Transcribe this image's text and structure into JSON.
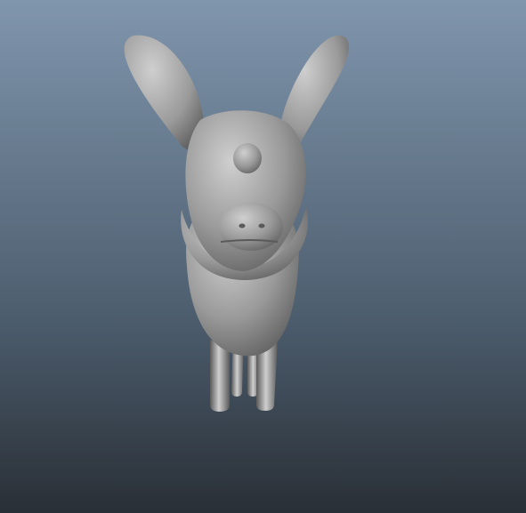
{
  "viewport": {
    "background_top_color": "#8096ad",
    "background_mid_color": "#4e5f70",
    "background_bottom_color": "#292f36",
    "model_color": "#9a9a9a",
    "model_highlight_color": "#cfcfcf",
    "model_shadow_color": "#5a5a5a"
  },
  "model": {
    "icon": "creature-3d-model"
  }
}
